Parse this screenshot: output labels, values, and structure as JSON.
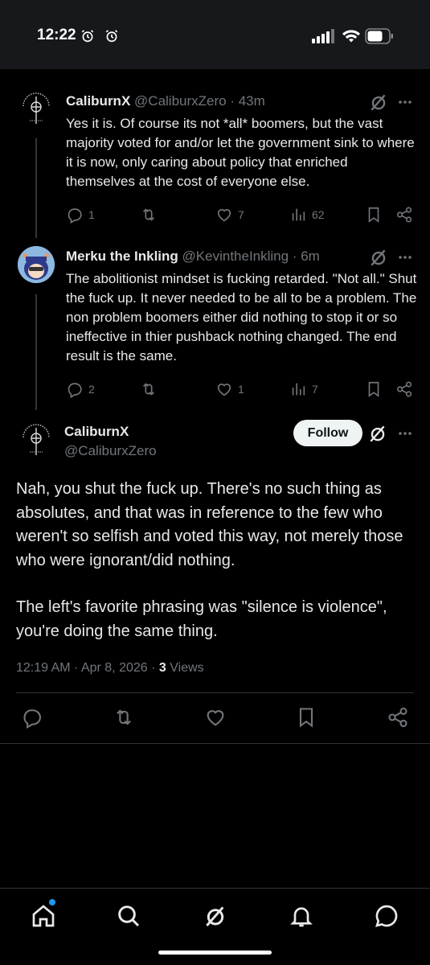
{
  "status_bar": {
    "time": "12:22"
  },
  "reply1": {
    "name": "CaliburnX",
    "handle": "@CaliburxZero",
    "time": "· 43m",
    "text": "Yes it is.  Of course its not *all* boomers, but the vast majority voted for and/or let the government sink to where it is now, only caring about policy that enriched themselves at the cost of everyone else.",
    "replies": "1",
    "likes": "7",
    "views": "62"
  },
  "reply2": {
    "name": "Merku the Inkling",
    "handle": "@KevintheInkling",
    "time": "· 6m",
    "text": "The abolitionist mindset is fucking retarded. \"Not all.\" Shut the fuck up. It never needed to be all to be a problem. The non problem boomers either did nothing to stop it or so ineffective in thier pushback nothing changed. The end result is the same.",
    "replies": "2",
    "likes": "1",
    "views": "7"
  },
  "main_post": {
    "name": "CaliburnX",
    "handle": "@CaliburxZero",
    "follow_label": "Follow",
    "paragraph1": "Nah, you shut the fuck up.  There's no such thing as absolutes, and that was in reference to the few who weren't so selfish and voted this way, not merely those who were ignorant/did nothing.",
    "paragraph2": "The left's favorite phrasing was \"silence is violence\", you're doing the same thing.",
    "timestamp": "12:19 AM · Apr 8, 2026 · ",
    "views_count": "3",
    "views_label": "Views"
  },
  "colors": {
    "accent": "#1d9bf0",
    "muted": "#71767b",
    "background": "#000000"
  },
  "icons": [
    "alarm-icon",
    "signal-icon",
    "wifi-icon",
    "battery-icon",
    "grok-icon",
    "more-icon",
    "reply-icon",
    "retweet-icon",
    "like-icon",
    "views-icon",
    "bookmark-icon",
    "share-icon",
    "home-icon",
    "search-icon",
    "notifications-icon",
    "messages-icon"
  ]
}
